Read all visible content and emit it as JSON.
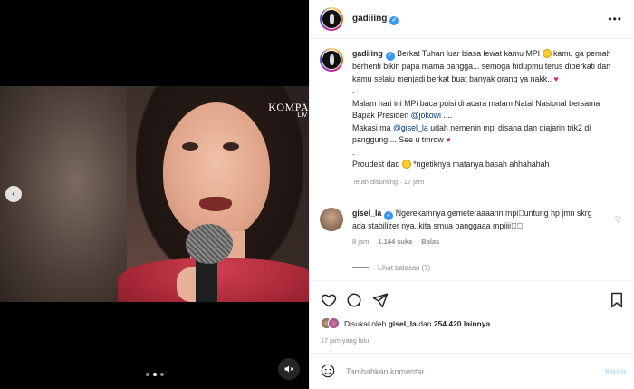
{
  "post": {
    "media": {
      "watermark": "KOMPA",
      "watermark_sub": "LIV",
      "carousel": {
        "count": 3,
        "active_index": 1
      },
      "prev_icon": "chevron-left-icon",
      "mute_icon": "speaker-muted-icon"
    },
    "header": {
      "username": "gadiiing",
      "verified_icon": "verified-badge-icon",
      "more_icon": "ellipsis-icon"
    },
    "caption": {
      "username": "gadiiing",
      "line1": "Berkat Tuhan luar biasa lewat kamu MPI",
      "line1b": "kamu ga pernah berhenti bikin papa mama bangga... semoga hidupmu terus diberkati dan kamu selalu menjadi berkat buat banyak orang ya nakk..",
      "dot1": ".",
      "p2a": "Malam hari ini MPi baca puisi di acara malam Natal Nasional bersama Bapak Presiden",
      "p2_mention": "@jokowi",
      "p2b": "....",
      "p3a": "Makasi ma",
      "p3_mention": "@gisel_la",
      "p3b": "udah nemenin mpi disana dan diajarin trik2 di panggung.... See u tmrow",
      "dot2": ".",
      "p4a": "Proudest dad",
      "p4b": "*ngetiknya matanya basah ahhahahah",
      "edited": "Telah disunting",
      "dot_sep": "·",
      "time": "17 jam"
    },
    "comment": {
      "username": "gisel_la",
      "text": "Ngerekamnya gemeteraaaann mpi\u0000untung hp jmn skrg ada stabilizer nya..kita smua banggaaa mpiiii\u0000\u0000",
      "time": "8 jam",
      "likes": "1.144 suka",
      "reply": "Balas",
      "view_replies": "Lihat balasan (7)",
      "like_icon": "heart-outline-icon"
    },
    "actions": {
      "like_icon": "heart-outline-icon",
      "comment_icon": "comment-bubble-icon",
      "share_icon": "paper-plane-icon",
      "save_icon": "bookmark-icon"
    },
    "likes": {
      "prefix": "Disukai oleh",
      "user": "gisel_la",
      "joiner": "dan",
      "count": "254.420 lainnya"
    },
    "time_ago": "17 jam yang lalu",
    "add_comment": {
      "emoji_icon": "smiley-icon",
      "placeholder": "Tambahkan komentar...",
      "post_label": "Kirim"
    }
  }
}
